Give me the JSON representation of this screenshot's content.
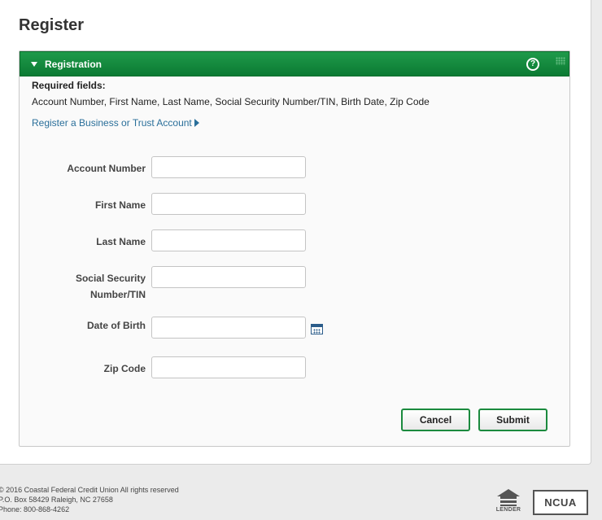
{
  "page": {
    "title": "Register"
  },
  "panel": {
    "title": "Registration",
    "required_label": "Required fields:",
    "required_list": "Account Number, First Name, Last Name, Social Security Number/TIN, Birth Date, Zip Code",
    "business_link": "Register a Business or Trust Account",
    "header_color": "#0b7a33"
  },
  "form": {
    "account_number": {
      "label": "Account Number",
      "value": ""
    },
    "first_name": {
      "label": "First Name",
      "value": ""
    },
    "last_name": {
      "label": "Last Name",
      "value": ""
    },
    "ssn": {
      "label_line1": "Social Security",
      "label_line2": "Number/TIN",
      "value": ""
    },
    "dob": {
      "label": "Date of Birth",
      "value": ""
    },
    "zip": {
      "label": "Zip Code",
      "value": ""
    }
  },
  "buttons": {
    "cancel": "Cancel",
    "submit": "Submit"
  },
  "footer": {
    "copyright": "© 2016 Coastal Federal Credit Union All rights reserved",
    "address": "P.O. Box 58429 Raleigh, NC 27658",
    "phone": "Phone: 800-868-4262",
    "ehl_text": "LENDER",
    "ncua_text": "NCUA"
  },
  "icons": [
    "caret-down-icon",
    "help-icon",
    "grip-icon",
    "arrow-right-icon",
    "calendar-icon",
    "equal-housing-lender-logo",
    "ncua-logo"
  ]
}
